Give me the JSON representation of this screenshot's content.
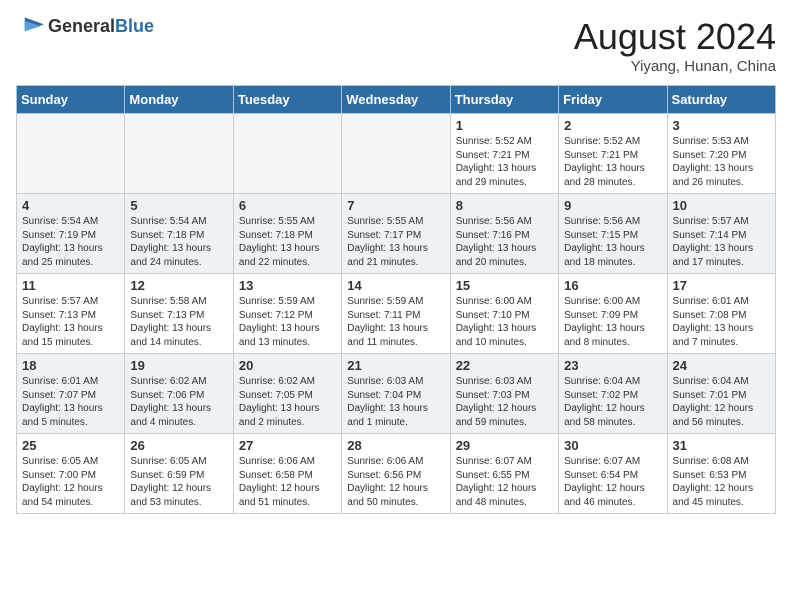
{
  "header": {
    "logo_general": "General",
    "logo_blue": "Blue",
    "title": "August 2024",
    "location": "Yiyang, Hunan, China"
  },
  "weekdays": [
    "Sunday",
    "Monday",
    "Tuesday",
    "Wednesday",
    "Thursday",
    "Friday",
    "Saturday"
  ],
  "weeks": [
    [
      {
        "day": "",
        "info": ""
      },
      {
        "day": "",
        "info": ""
      },
      {
        "day": "",
        "info": ""
      },
      {
        "day": "",
        "info": ""
      },
      {
        "day": "1",
        "info": "Sunrise: 5:52 AM\nSunset: 7:21 PM\nDaylight: 13 hours\nand 29 minutes."
      },
      {
        "day": "2",
        "info": "Sunrise: 5:52 AM\nSunset: 7:21 PM\nDaylight: 13 hours\nand 28 minutes."
      },
      {
        "day": "3",
        "info": "Sunrise: 5:53 AM\nSunset: 7:20 PM\nDaylight: 13 hours\nand 26 minutes."
      }
    ],
    [
      {
        "day": "4",
        "info": "Sunrise: 5:54 AM\nSunset: 7:19 PM\nDaylight: 13 hours\nand 25 minutes."
      },
      {
        "day": "5",
        "info": "Sunrise: 5:54 AM\nSunset: 7:18 PM\nDaylight: 13 hours\nand 24 minutes."
      },
      {
        "day": "6",
        "info": "Sunrise: 5:55 AM\nSunset: 7:18 PM\nDaylight: 13 hours\nand 22 minutes."
      },
      {
        "day": "7",
        "info": "Sunrise: 5:55 AM\nSunset: 7:17 PM\nDaylight: 13 hours\nand 21 minutes."
      },
      {
        "day": "8",
        "info": "Sunrise: 5:56 AM\nSunset: 7:16 PM\nDaylight: 13 hours\nand 20 minutes."
      },
      {
        "day": "9",
        "info": "Sunrise: 5:56 AM\nSunset: 7:15 PM\nDaylight: 13 hours\nand 18 minutes."
      },
      {
        "day": "10",
        "info": "Sunrise: 5:57 AM\nSunset: 7:14 PM\nDaylight: 13 hours\nand 17 minutes."
      }
    ],
    [
      {
        "day": "11",
        "info": "Sunrise: 5:57 AM\nSunset: 7:13 PM\nDaylight: 13 hours\nand 15 minutes."
      },
      {
        "day": "12",
        "info": "Sunrise: 5:58 AM\nSunset: 7:13 PM\nDaylight: 13 hours\nand 14 minutes."
      },
      {
        "day": "13",
        "info": "Sunrise: 5:59 AM\nSunset: 7:12 PM\nDaylight: 13 hours\nand 13 minutes."
      },
      {
        "day": "14",
        "info": "Sunrise: 5:59 AM\nSunset: 7:11 PM\nDaylight: 13 hours\nand 11 minutes."
      },
      {
        "day": "15",
        "info": "Sunrise: 6:00 AM\nSunset: 7:10 PM\nDaylight: 13 hours\nand 10 minutes."
      },
      {
        "day": "16",
        "info": "Sunrise: 6:00 AM\nSunset: 7:09 PM\nDaylight: 13 hours\nand 8 minutes."
      },
      {
        "day": "17",
        "info": "Sunrise: 6:01 AM\nSunset: 7:08 PM\nDaylight: 13 hours\nand 7 minutes."
      }
    ],
    [
      {
        "day": "18",
        "info": "Sunrise: 6:01 AM\nSunset: 7:07 PM\nDaylight: 13 hours\nand 5 minutes."
      },
      {
        "day": "19",
        "info": "Sunrise: 6:02 AM\nSunset: 7:06 PM\nDaylight: 13 hours\nand 4 minutes."
      },
      {
        "day": "20",
        "info": "Sunrise: 6:02 AM\nSunset: 7:05 PM\nDaylight: 13 hours\nand 2 minutes."
      },
      {
        "day": "21",
        "info": "Sunrise: 6:03 AM\nSunset: 7:04 PM\nDaylight: 13 hours\nand 1 minute."
      },
      {
        "day": "22",
        "info": "Sunrise: 6:03 AM\nSunset: 7:03 PM\nDaylight: 12 hours\nand 59 minutes."
      },
      {
        "day": "23",
        "info": "Sunrise: 6:04 AM\nSunset: 7:02 PM\nDaylight: 12 hours\nand 58 minutes."
      },
      {
        "day": "24",
        "info": "Sunrise: 6:04 AM\nSunset: 7:01 PM\nDaylight: 12 hours\nand 56 minutes."
      }
    ],
    [
      {
        "day": "25",
        "info": "Sunrise: 6:05 AM\nSunset: 7:00 PM\nDaylight: 12 hours\nand 54 minutes."
      },
      {
        "day": "26",
        "info": "Sunrise: 6:05 AM\nSunset: 6:59 PM\nDaylight: 12 hours\nand 53 minutes."
      },
      {
        "day": "27",
        "info": "Sunrise: 6:06 AM\nSunset: 6:58 PM\nDaylight: 12 hours\nand 51 minutes."
      },
      {
        "day": "28",
        "info": "Sunrise: 6:06 AM\nSunset: 6:56 PM\nDaylight: 12 hours\nand 50 minutes."
      },
      {
        "day": "29",
        "info": "Sunrise: 6:07 AM\nSunset: 6:55 PM\nDaylight: 12 hours\nand 48 minutes."
      },
      {
        "day": "30",
        "info": "Sunrise: 6:07 AM\nSunset: 6:54 PM\nDaylight: 12 hours\nand 46 minutes."
      },
      {
        "day": "31",
        "info": "Sunrise: 6:08 AM\nSunset: 6:53 PM\nDaylight: 12 hours\nand 45 minutes."
      }
    ]
  ]
}
